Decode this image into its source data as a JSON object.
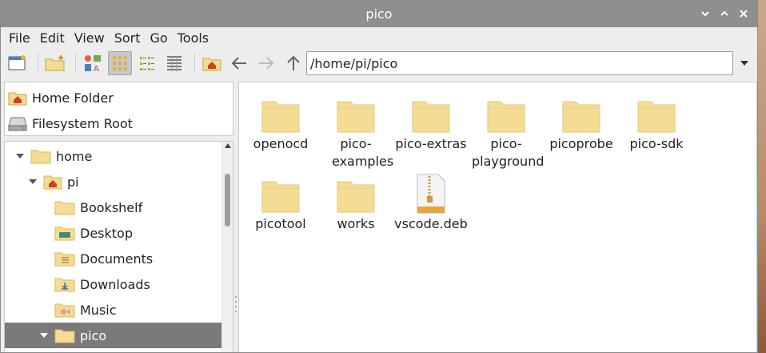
{
  "window": {
    "title": "pico"
  },
  "menubar": [
    "File",
    "Edit",
    "View",
    "Sort",
    "Go",
    "Tools"
  ],
  "toolbar": {
    "path": "/home/pi/pico"
  },
  "places": [
    {
      "label": "Home Folder",
      "icon": "home-folder-icon"
    },
    {
      "label": "Filesystem Root",
      "icon": "drive-icon"
    }
  ],
  "tree": [
    {
      "label": "home",
      "icon": "folder-icon"
    },
    {
      "label": "pi",
      "icon": "home-folder-icon"
    },
    {
      "label": "Bookshelf",
      "icon": "folder-icon"
    },
    {
      "label": "Desktop",
      "icon": "desktop-folder-icon"
    },
    {
      "label": "Documents",
      "icon": "documents-folder-icon"
    },
    {
      "label": "Downloads",
      "icon": "downloads-folder-icon"
    },
    {
      "label": "Music",
      "icon": "music-folder-icon"
    },
    {
      "label": "pico",
      "icon": "folder-icon"
    }
  ],
  "files": [
    {
      "label": "openocd",
      "type": "folder"
    },
    {
      "label": "pico-examples",
      "type": "folder"
    },
    {
      "label": "pico-extras",
      "type": "folder"
    },
    {
      "label": "pico-playground",
      "type": "folder"
    },
    {
      "label": "picoprobe",
      "type": "folder"
    },
    {
      "label": "pico-sdk",
      "type": "folder"
    },
    {
      "label": "picotool",
      "type": "folder"
    },
    {
      "label": "works",
      "type": "folder"
    },
    {
      "label": "vscode.deb",
      "type": "archive"
    }
  ],
  "colors": {
    "folder": "#f5dc95",
    "folder_edge": "#d9b85a",
    "selection": "#7a7a7a",
    "titlebar": "#8f8f8f"
  }
}
